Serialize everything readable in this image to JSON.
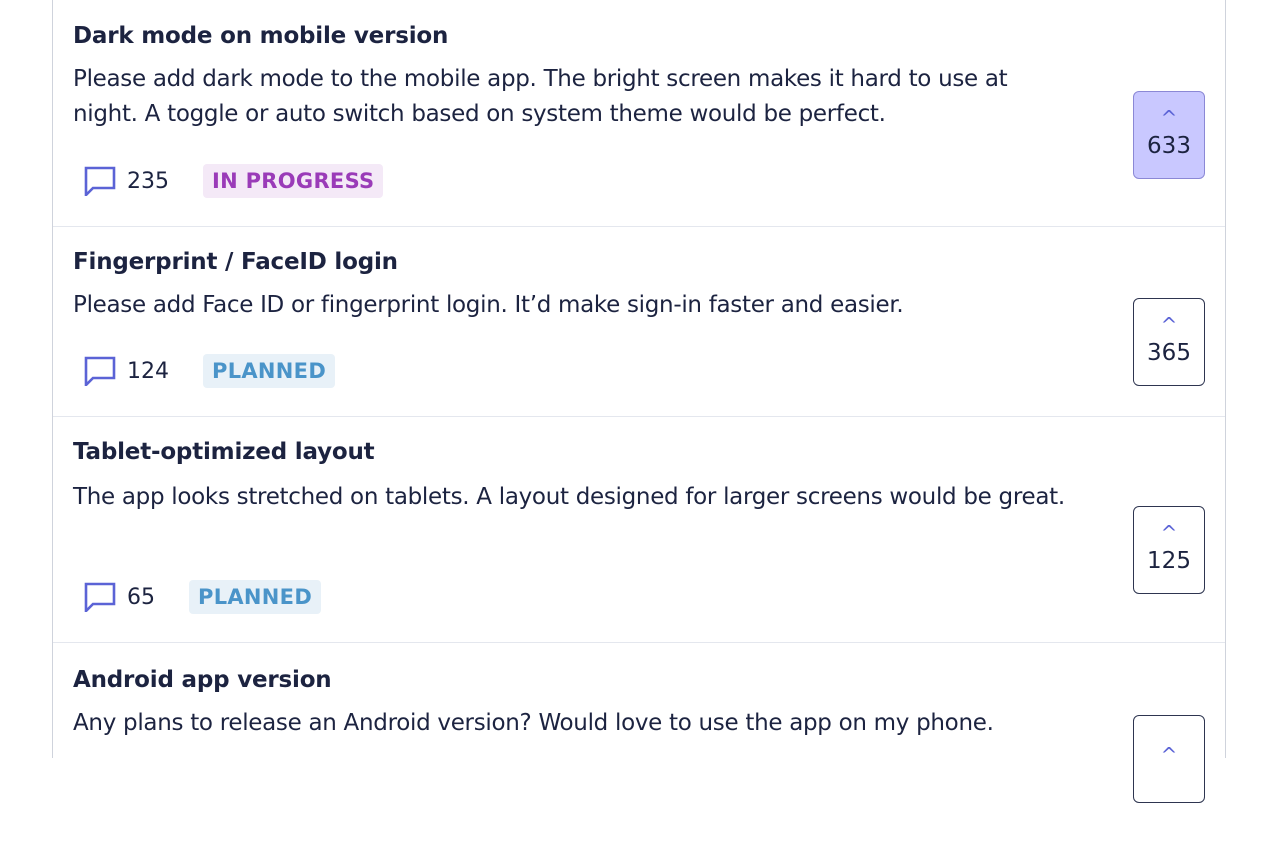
{
  "items": [
    {
      "title": "Dark mode on mobile version",
      "description": "Please add dark mode to the mobile app. The bright screen makes it hard to use at night. A toggle or auto switch based on system theme would be perfect.",
      "comments": "235",
      "status": "IN PROGRESS",
      "votes": "633",
      "voted": true
    },
    {
      "title": "Fingerprint / FaceID login",
      "description": "Please add Face ID or fingerprint login. It’d make sign-in faster and easier.",
      "comments": "124",
      "status": "PLANNED",
      "votes": "365",
      "voted": false
    },
    {
      "title": "Tablet-optimized layout",
      "description": "The app looks stretched on tablets. A layout designed for larger screens would be great.",
      "comments": "65",
      "status": "PLANNED",
      "votes": "125",
      "voted": false
    },
    {
      "title": "Android app version",
      "description": "Any plans to release an Android version? Would love to use the app on my phone.",
      "comments": "",
      "status": "",
      "votes": "",
      "voted": false
    }
  ],
  "icons": {
    "comment": "comment-icon",
    "upvote": "chevron-up-icon"
  },
  "colors": {
    "text": "#1c2340",
    "accent": "#5b63d6",
    "voted_bg": "#c9c8ff",
    "in_progress": "#9a3bb8",
    "planned": "#4a94c9"
  }
}
